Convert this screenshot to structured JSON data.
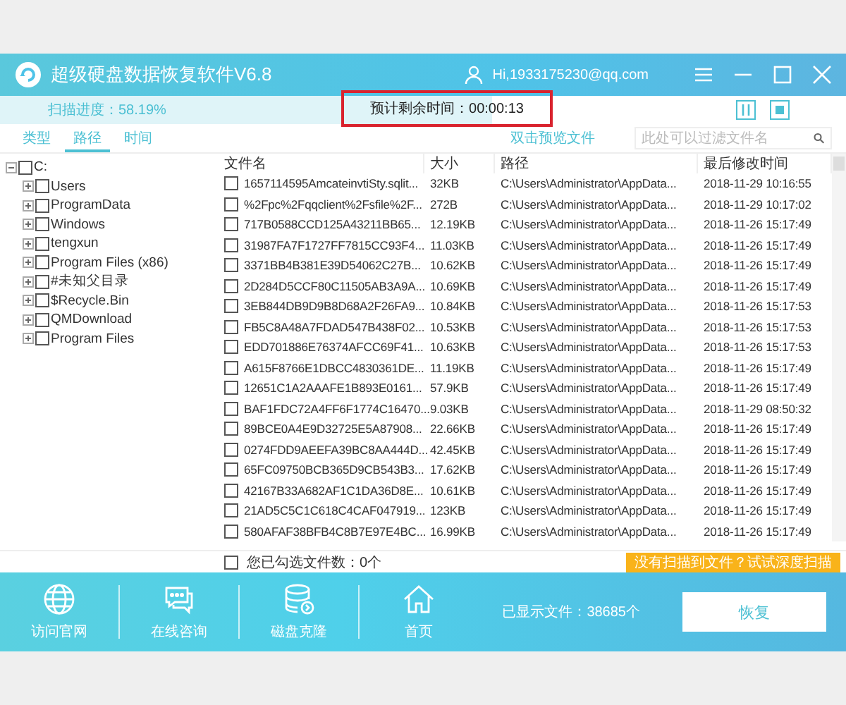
{
  "window": {
    "title": "超级硬盘数据恢复软件V6.8",
    "account": "Hi,1933175230@qq.com"
  },
  "scan": {
    "label": "扫描进度：58.19%",
    "level": 0.5819,
    "remaining": "预计剩余时间：00:00:13"
  },
  "tabs": [
    {
      "label": "类型",
      "selected": false
    },
    {
      "label": "路径",
      "selected": true
    },
    {
      "label": "时间",
      "selected": false
    }
  ],
  "preview_link": "双击预览文件",
  "filter": {
    "placeholder": "此处可以过滤文件名"
  },
  "tree": [
    {
      "label": "C:",
      "checked": false,
      "expanded": true,
      "children": [
        {
          "label": "Users",
          "checked": false,
          "expanded": false
        },
        {
          "label": "ProgramData",
          "checked": false,
          "expanded": false
        },
        {
          "label": "Windows",
          "checked": false,
          "expanded": false
        },
        {
          "label": "tengxun",
          "checked": false,
          "expanded": false
        },
        {
          "label": "Program Files (x86)",
          "checked": false,
          "expanded": false
        },
        {
          "label": "#未知父目录",
          "checked": false,
          "expanded": false
        },
        {
          "label": "$Recycle.Bin",
          "checked": false,
          "expanded": false
        },
        {
          "label": "QMDownload",
          "checked": false,
          "expanded": false
        },
        {
          "label": "Program Files",
          "checked": false,
          "expanded": false
        }
      ]
    }
  ],
  "table": {
    "columns": [
      "文件名",
      "大小",
      "路径",
      "最后修改时间"
    ],
    "rows": [
      {
        "checked": false,
        "cells": [
          "1657114595AmcateinvtiSty.sqlit...",
          "32KB",
          "C:\\Users\\Administrator\\AppData...",
          "2018-11-29 10:16:55"
        ]
      },
      {
        "checked": false,
        "cells": [
          "%2Fpc%2Fqqclient%2Fsfile%2F...",
          "272B",
          "C:\\Users\\Administrator\\AppData...",
          "2018-11-29 10:17:02"
        ]
      },
      {
        "checked": false,
        "cells": [
          "717B0588CCD125A43211BB65...",
          "12.19KB",
          "C:\\Users\\Administrator\\AppData...",
          "2018-11-26 15:17:49"
        ]
      },
      {
        "checked": false,
        "cells": [
          "31987FA7F1727FF7815CC93F4...",
          "11.03KB",
          "C:\\Users\\Administrator\\AppData...",
          "2018-11-26 15:17:49"
        ]
      },
      {
        "checked": false,
        "cells": [
          "3371BB4B381E39D54062C27B...",
          "10.62KB",
          "C:\\Users\\Administrator\\AppData...",
          "2018-11-26 15:17:49"
        ]
      },
      {
        "checked": false,
        "cells": [
          "2D284D5CCF80C11505AB3A9A...",
          "10.69KB",
          "C:\\Users\\Administrator\\AppData...",
          "2018-11-26 15:17:49"
        ]
      },
      {
        "checked": false,
        "cells": [
          "3EB844DB9D9B8D68A2F26FA9...",
          "10.84KB",
          "C:\\Users\\Administrator\\AppData...",
          "2018-11-26 15:17:53"
        ]
      },
      {
        "checked": false,
        "cells": [
          "FB5C8A48A7FDAD547B438F02...",
          "10.53KB",
          "C:\\Users\\Administrator\\AppData...",
          "2018-11-26 15:17:53"
        ]
      },
      {
        "checked": false,
        "cells": [
          "EDD701886E76374AFCC69F41...",
          "10.63KB",
          "C:\\Users\\Administrator\\AppData...",
          "2018-11-26 15:17:53"
        ]
      },
      {
        "checked": false,
        "cells": [
          "A615F8766E1DBCC4830361DE...",
          "11.19KB",
          "C:\\Users\\Administrator\\AppData...",
          "2018-11-26 15:17:49"
        ]
      },
      {
        "checked": false,
        "cells": [
          "12651C1A2AAAFE1B893E0161...",
          "57.9KB",
          "C:\\Users\\Administrator\\AppData...",
          "2018-11-26 15:17:49"
        ]
      },
      {
        "checked": false,
        "cells": [
          "BAF1FDC72A4FF6F1774C16470...",
          "9.03KB",
          "C:\\Users\\Administrator\\AppData...",
          "2018-11-29 08:50:32"
        ]
      },
      {
        "checked": false,
        "cells": [
          "89BCE0A4E9D32725E5A87908...",
          "22.66KB",
          "C:\\Users\\Administrator\\AppData...",
          "2018-11-26 15:17:49"
        ]
      },
      {
        "checked": false,
        "cells": [
          "0274FDD9AEEFA39BC8AA444D...",
          "42.45KB",
          "C:\\Users\\Administrator\\AppData...",
          "2018-11-26 15:17:49"
        ]
      },
      {
        "checked": false,
        "cells": [
          "65FC09750BCB365D9CB543B3...",
          "17.62KB",
          "C:\\Users\\Administrator\\AppData...",
          "2018-11-26 15:17:49"
        ]
      },
      {
        "checked": false,
        "cells": [
          "42167B33A682AF1C1DA36D8E...",
          "10.61KB",
          "C:\\Users\\Administrator\\AppData...",
          "2018-11-26 15:17:49"
        ]
      },
      {
        "checked": false,
        "cells": [
          "21AD5C5C1C618C4CAF047919...",
          "123KB",
          "C:\\Users\\Administrator\\AppData...",
          "2018-11-26 15:17:49"
        ]
      },
      {
        "checked": false,
        "cells": [
          "580AFAF38BFB4C8B7E97E4BC...",
          "16.99KB",
          "C:\\Users\\Administrator\\AppData...",
          "2018-11-26 15:17:49"
        ]
      }
    ]
  },
  "selection": {
    "label": "您已勾选文件数：0个",
    "checked": false
  },
  "deep_scan_button": "没有扫描到文件？试试深度扫描",
  "nav": [
    {
      "kind": "globe",
      "label": "访问官网"
    },
    {
      "kind": "chat",
      "label": "在线咨询"
    },
    {
      "kind": "database",
      "label": "磁盘克隆"
    },
    {
      "kind": "home",
      "label": "首页"
    }
  ],
  "shown_count": "已显示文件：38685个",
  "recover_button": "恢复"
}
